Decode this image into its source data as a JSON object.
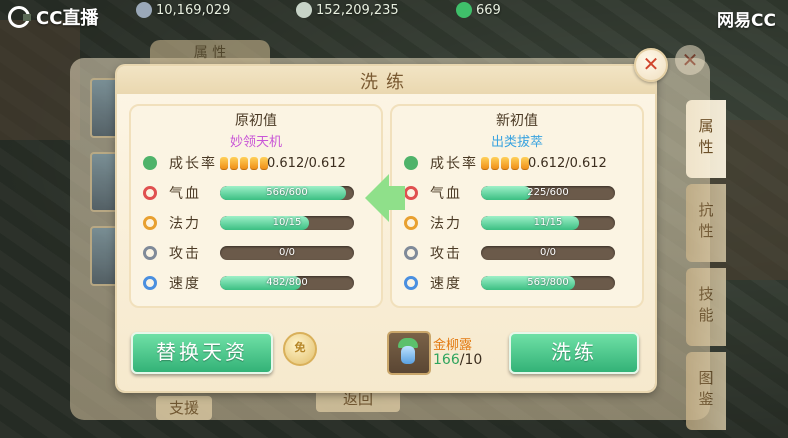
{
  "hud": {
    "cc_label": "CC直播",
    "stat1": "10,169,029",
    "stat2": "152,209,235",
    "stat3": "669",
    "netease_label": "网易CC"
  },
  "background": {
    "top_tab": "属 性",
    "side_tabs": [
      "属性",
      "抗性",
      "技能",
      "图鉴"
    ],
    "support_button": "支援",
    "back_button": "返回",
    "close_label": "✕"
  },
  "dialog": {
    "title": "洗练",
    "close_label": "✕",
    "left": {
      "title": "原初值",
      "subtitle": "妙领天机",
      "growth": {
        "label": "成长率",
        "value": "0.612/0.612",
        "pips": 5
      },
      "stats": [
        {
          "label": "气血",
          "text": "566/600",
          "ratio": 0.943,
          "icon_color": "#e05050"
        },
        {
          "label": "法力",
          "text": "10/15",
          "ratio": 0.667,
          "icon_color": "#e8a030"
        },
        {
          "label": "攻击",
          "text": "0/0",
          "ratio": 0,
          "icon_color": "#7f8a99"
        },
        {
          "label": "速度",
          "text": "482/800",
          "ratio": 0.6025,
          "icon_color": "#4a8fe0"
        }
      ]
    },
    "right": {
      "title": "新初值",
      "subtitle": "出类拔萃",
      "growth": {
        "label": "成长率",
        "value": "0.612/0.612",
        "pips": 5
      },
      "stats": [
        {
          "label": "气血",
          "text": "225/600",
          "ratio": 0.375,
          "icon_color": "#e05050"
        },
        {
          "label": "法力",
          "text": "11/15",
          "ratio": 0.733,
          "icon_color": "#e8a030"
        },
        {
          "label": "攻击",
          "text": "0/0",
          "ratio": 0,
          "icon_color": "#7f8a99"
        },
        {
          "label": "速度",
          "text": "563/800",
          "ratio": 0.704,
          "icon_color": "#4a8fe0"
        }
      ]
    },
    "replace_button": "替换天资",
    "coin_label": "免",
    "item": {
      "name": "金柳露",
      "have": "166",
      "need": "/10"
    },
    "refine_button": "洗练"
  },
  "colors": {
    "bar_fill": "#3bbf83",
    "growth_pip": "#ef8a12",
    "button": "#33b277"
  }
}
